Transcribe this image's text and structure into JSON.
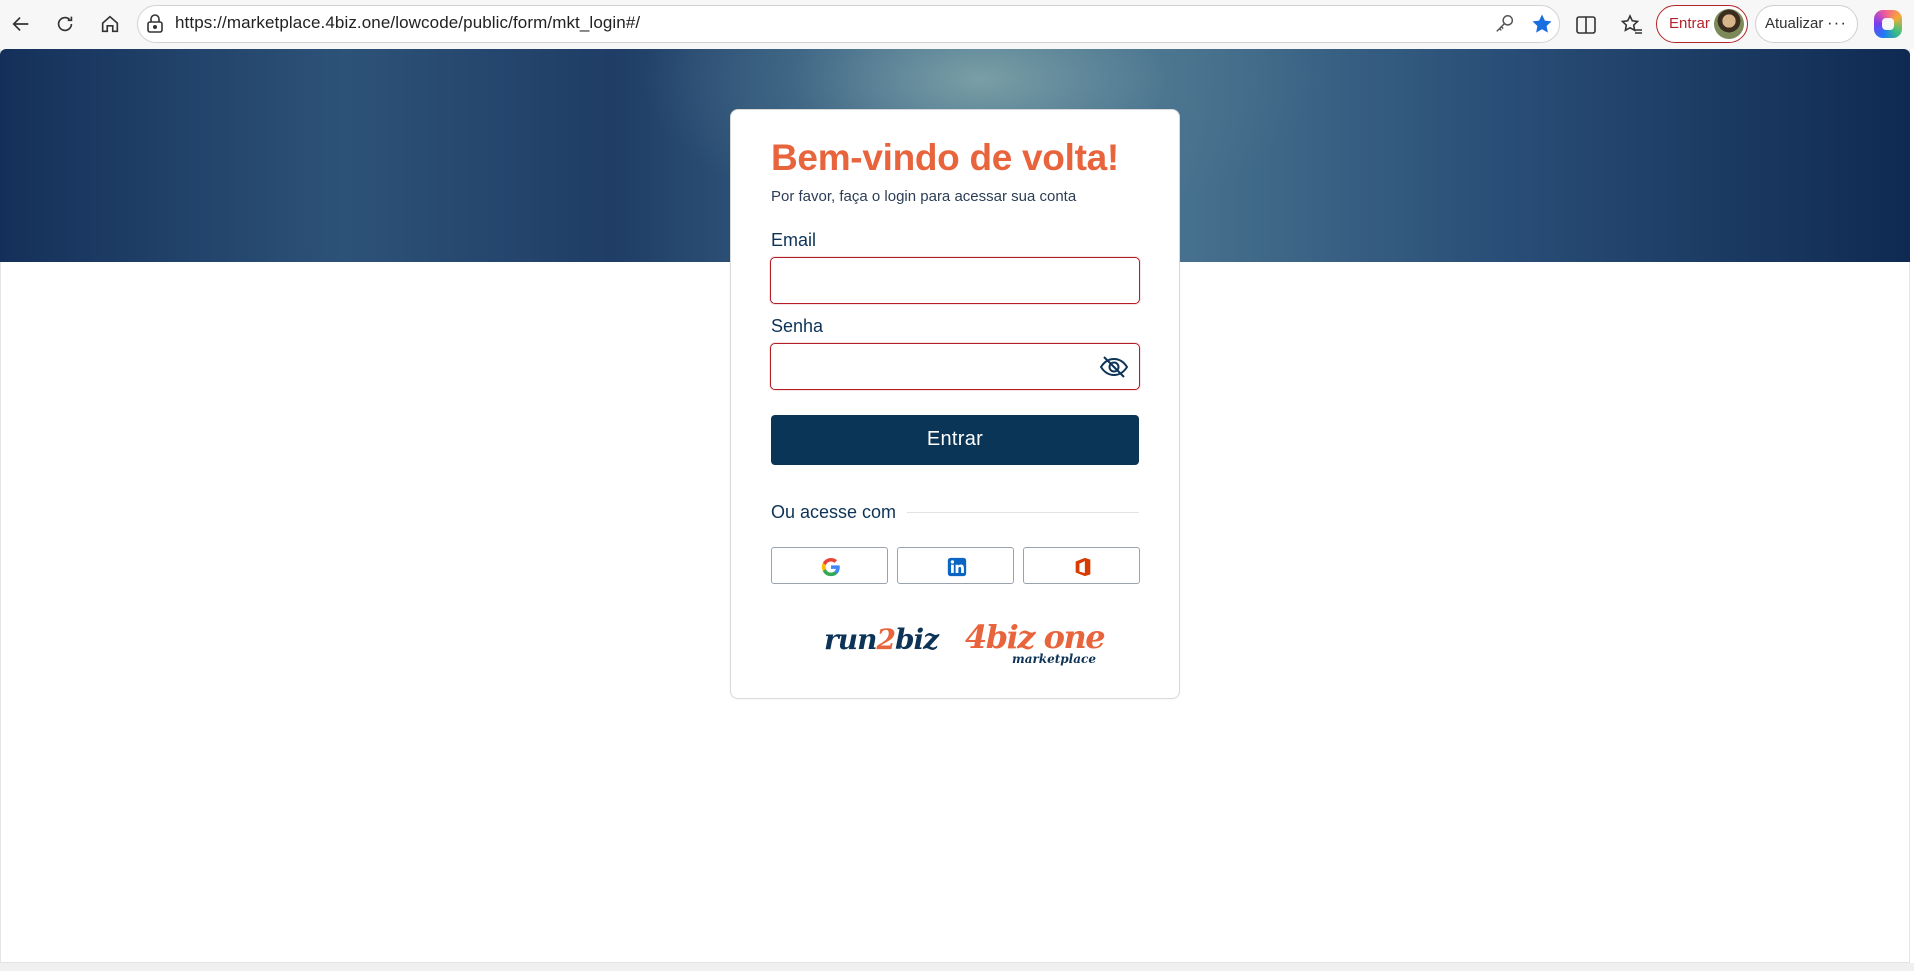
{
  "browser": {
    "url": "https://marketplace.4biz.one/lowcode/public/form/mkt_login#/",
    "signin_label": "Entrar",
    "update_label": "Atualizar",
    "more_label": "···",
    "icons": [
      "back-arrow-icon",
      "refresh-icon",
      "home-icon",
      "lock-icon",
      "key-icon",
      "star-filled-icon",
      "split-screen-icon",
      "favorites-icon",
      "copilot-icon"
    ]
  },
  "login": {
    "title": "Bem-vindo de volta!",
    "subtitle": "Por favor, faça o login para acessar sua conta",
    "email_label": "Email",
    "email_value": "",
    "password_label": "Senha",
    "password_value": "",
    "submit_label": "Entrar",
    "or_label": "Ou acesse com"
  },
  "sso": [
    "google-icon",
    "linkedin-icon",
    "office-icon"
  ],
  "logos": {
    "run2biz": {
      "part1": "run",
      "part2": "2",
      "part3": "biz"
    },
    "fourbiz": {
      "main": "4biz one",
      "sub": "marketplace"
    }
  },
  "colors": {
    "accent": "#e8643c",
    "primary": "#0b3557",
    "error_border": "#b21c25"
  }
}
